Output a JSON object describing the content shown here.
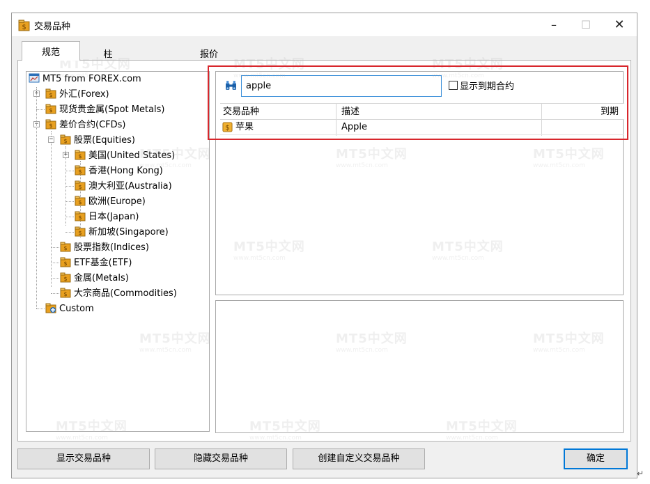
{
  "window": {
    "title": "交易品种",
    "minimize": "–",
    "maximize": "☐",
    "close": "✕"
  },
  "tabs": [
    {
      "label": "规范",
      "active": true
    },
    {
      "label": "柱",
      "active": false
    },
    {
      "label": "报价",
      "active": false
    }
  ],
  "tree": {
    "root": "MT5 from FOREX.com",
    "items": [
      {
        "label": "外汇(Forex)"
      },
      {
        "label": "现货贵金属(Spot Metals)"
      },
      {
        "label": "差价合约(CFDs)"
      },
      {
        "label": "股票(Equities)"
      },
      {
        "label": "美国(United States)"
      },
      {
        "label": "香港(Hong Kong)"
      },
      {
        "label": "澳大利亚(Australia)"
      },
      {
        "label": "欧洲(Europe)"
      },
      {
        "label": "日本(Japan)"
      },
      {
        "label": "新加坡(Singapore)"
      },
      {
        "label": "股票指数(Indices)"
      },
      {
        "label": "ETF基金(ETF)"
      },
      {
        "label": "金属(Metals)"
      },
      {
        "label": "大宗商品(Commodities)"
      },
      {
        "label": "Custom"
      }
    ]
  },
  "search": {
    "value": "apple",
    "show_expired_label": "显示到期合约",
    "show_expired_checked": false
  },
  "results": {
    "columns": [
      "交易品种",
      "描述",
      "到期"
    ],
    "rows": [
      {
        "symbol": "苹果",
        "description": "Apple",
        "expiry": ""
      }
    ]
  },
  "footer": {
    "show_symbol": "显示交易品种",
    "hide_symbol": "隐藏交易品种",
    "create_custom": "创建自定义交易品种",
    "ok": "确定"
  },
  "watermark": {
    "text": "MT5中文网",
    "sub": "www.mt5cn.com"
  },
  "colors": {
    "highlight": "#d8262c",
    "focus": "#3b8fd9",
    "folder": "#e8a020"
  }
}
